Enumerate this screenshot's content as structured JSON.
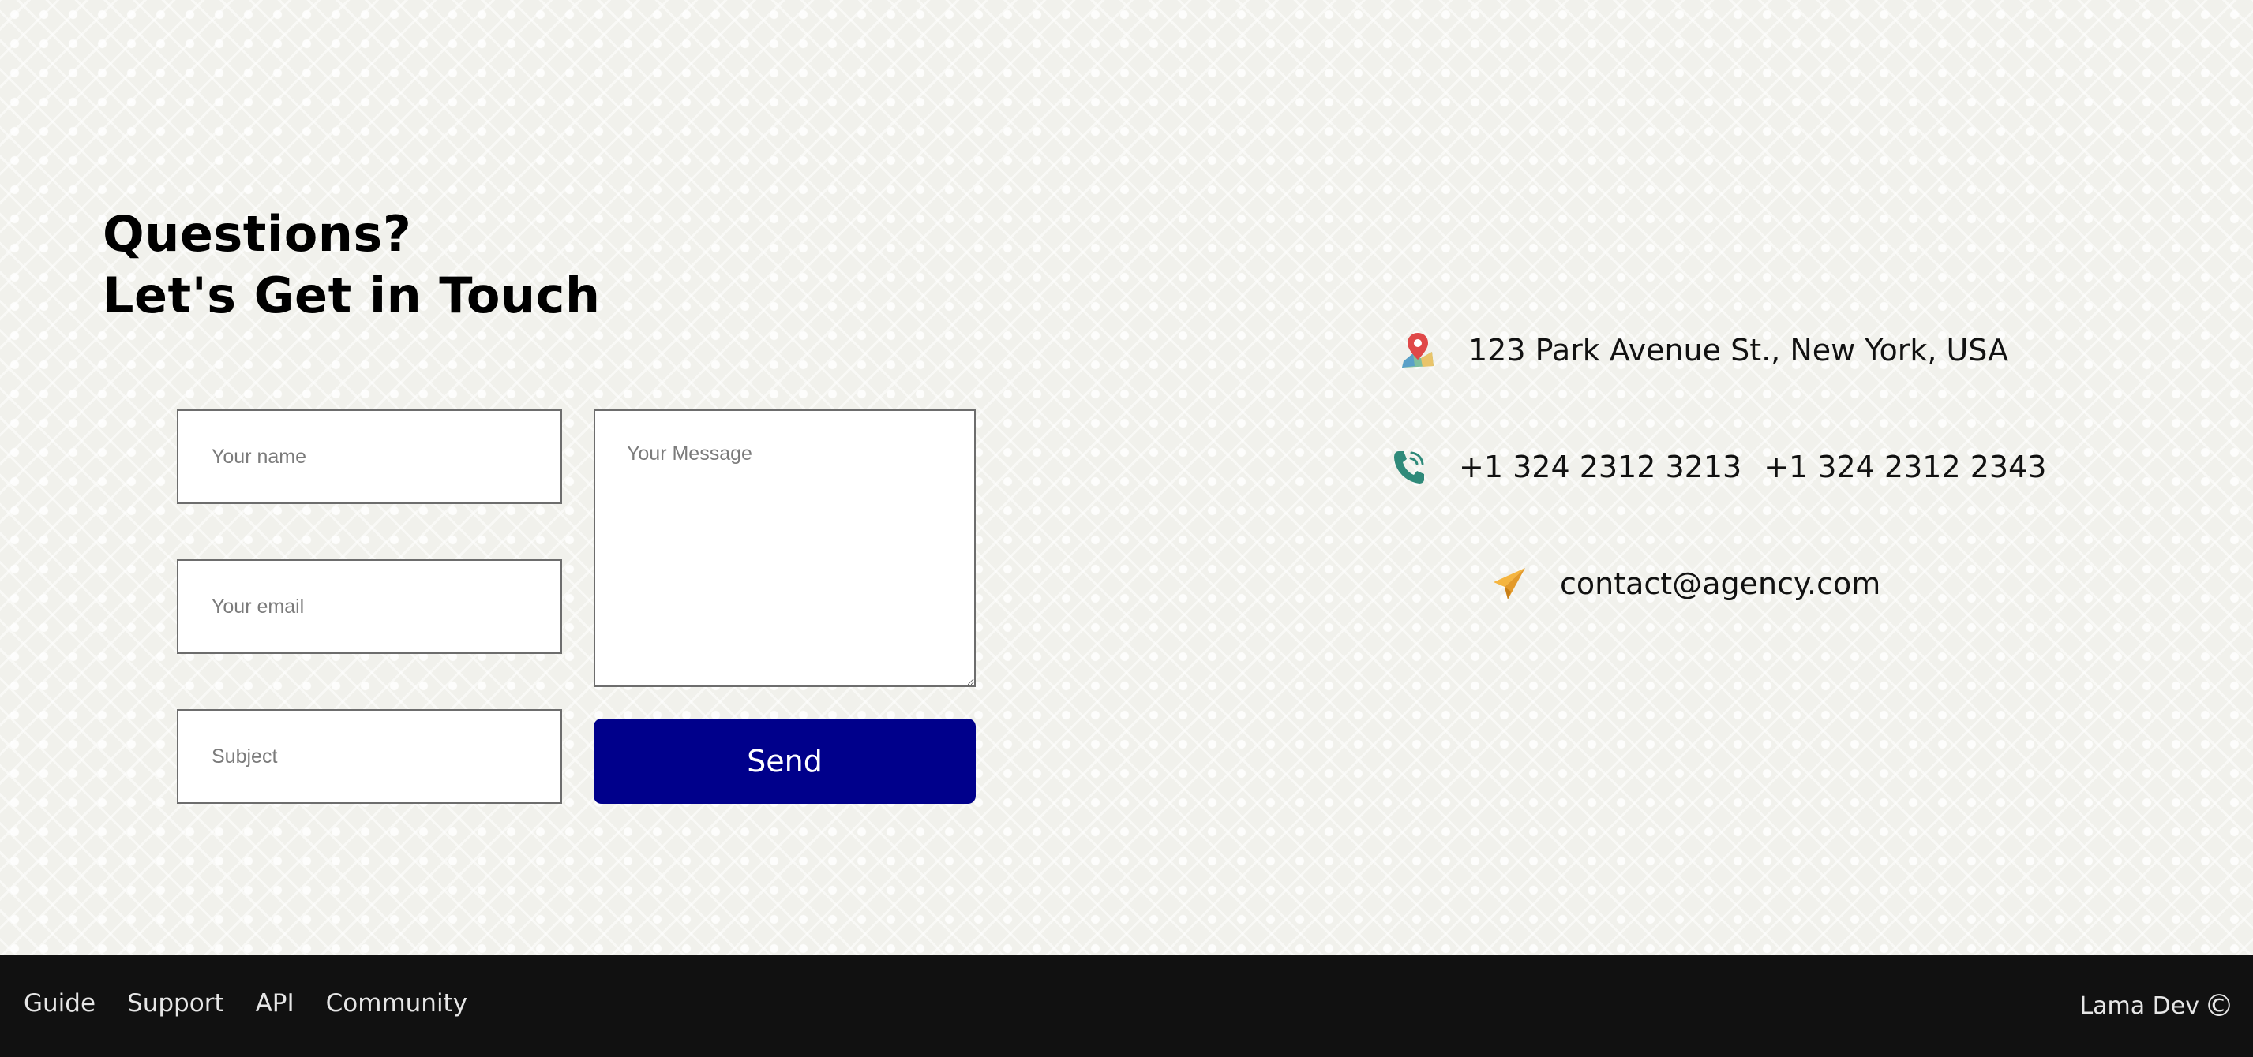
{
  "contact": {
    "title_line1": "Questions?",
    "title_line2": "Let's Get in Touch",
    "form": {
      "name_placeholder": "Your name",
      "email_placeholder": "Your email",
      "subject_placeholder": "Subject",
      "message_placeholder": "Your Message",
      "send_label": "Send"
    },
    "info": {
      "address": "123 Park Avenue St., New York, USA",
      "phone1": "+1 324 2312 3213",
      "phone2": "+1 324 2312 2343",
      "email": "contact@agency.com"
    },
    "icons": {
      "address": "map-pin-icon",
      "phone": "phone-icon",
      "email": "paper-plane-icon"
    }
  },
  "footer": {
    "links": [
      "Guide",
      "Support",
      "API",
      "Community"
    ],
    "copyright": "Lama Dev",
    "copyright_symbol": "©"
  },
  "colors": {
    "background": "#f1f1ec",
    "send_button": "#00008b",
    "footer_bg": "#111111",
    "footer_text": "#e6e6e6",
    "phone_icon": "#2f8a7a",
    "plane_icon": "#f5b53f"
  }
}
